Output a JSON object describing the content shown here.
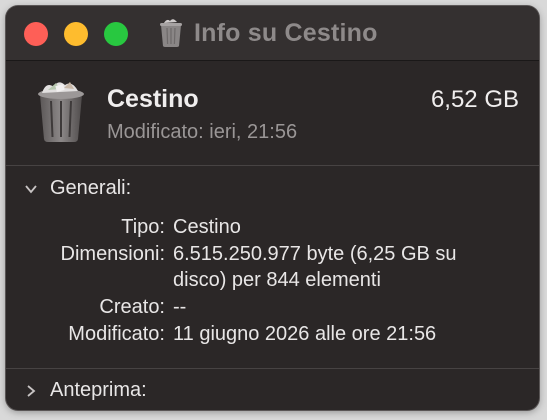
{
  "window": {
    "title": "Info su Cestino"
  },
  "header": {
    "name": "Cestino",
    "size": "6,52 GB",
    "modified": "Modificato: ieri, 21:56"
  },
  "sections": {
    "general": {
      "label": "Generali:",
      "expanded": true
    },
    "preview": {
      "label": "Anteprima:",
      "expanded": false
    }
  },
  "general": {
    "rows": [
      {
        "label": "Tipo:",
        "value": "Cestino"
      },
      {
        "label": "Dimensioni:",
        "value": "6.515.250.977 byte (6,25 GB su disco) per 844 elementi"
      },
      {
        "label": "Creato:",
        "value": "--"
      },
      {
        "label": "Modificato:",
        "value": "11 giugno 2026 alle ore 21:56"
      }
    ]
  },
  "icons": {
    "title_icon": "trash-icon",
    "header_icon": "trash-full-icon",
    "general_toggle": "chevron-down-icon",
    "preview_toggle": "chevron-right-icon"
  },
  "colors": {
    "close": "#fe5f57",
    "minimize": "#febc2e",
    "zoom": "#28c840",
    "background": "#2b2727"
  }
}
